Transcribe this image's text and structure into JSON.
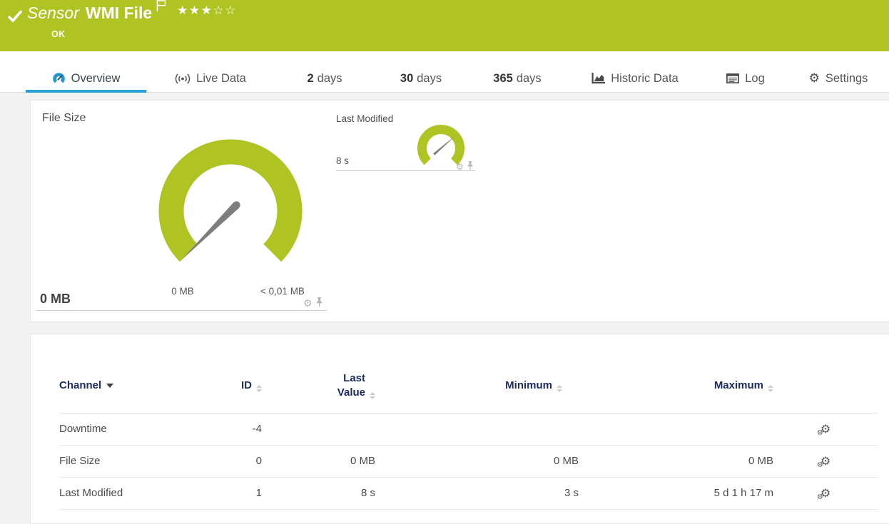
{
  "header": {
    "sensor_type_label": "Sensor",
    "sensor_name": "WMI File",
    "status": "OK",
    "rating_filled_count": 3,
    "rating_total": 5,
    "stars_filled": "★★★",
    "stars_empty": "☆☆"
  },
  "tabs": {
    "overview": {
      "label": "Overview"
    },
    "live_data": {
      "label": "Live Data"
    },
    "days2": {
      "num": "2",
      "unit": "days"
    },
    "days30": {
      "num": "30",
      "unit": "days"
    },
    "days365": {
      "num": "365",
      "unit": "days"
    },
    "historic": {
      "label": "Historic Data"
    },
    "log": {
      "label": "Log"
    },
    "settings": {
      "label": "Settings",
      "gear_glyph": "⚙"
    }
  },
  "gauges": {
    "file_size": {
      "title": "File Size",
      "value": "0 MB",
      "min_label": "0 MB",
      "max_label": "< 0,01 MB",
      "gear_glyph": "⚙"
    },
    "last_modified": {
      "title": "Last Modified",
      "value": "8 s",
      "gear_glyph": "⚙"
    }
  },
  "channel_table": {
    "headers": {
      "channel": "Channel",
      "id": "ID",
      "last_value": "Last Value",
      "minimum": "Minimum",
      "maximum": "Maximum"
    },
    "gear_glyph": "⚙",
    "rows": [
      {
        "channel": "Downtime",
        "id": "-4",
        "last_value": "",
        "minimum": "",
        "maximum": ""
      },
      {
        "channel": "File Size",
        "id": "0",
        "last_value": "0 MB",
        "minimum": "0 MB",
        "maximum": "0 MB"
      },
      {
        "channel": "Last Modified",
        "id": "1",
        "last_value": "8 s",
        "minimum": "3 s",
        "maximum": "5 d 1 h 17 m"
      }
    ]
  },
  "colors": {
    "brand_green": "#afc423",
    "accent_blue": "#29a1d8",
    "header_text_navy": "#1b2d60"
  }
}
